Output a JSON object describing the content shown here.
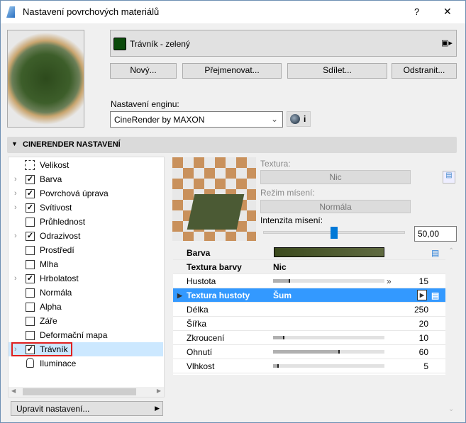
{
  "window": {
    "title": "Nastavení povrchových materiálů",
    "help": "?",
    "close": "✕"
  },
  "material": {
    "name": "Trávník - zelený",
    "swatch": "#0b4a0b"
  },
  "buttons": {
    "new": "Nový...",
    "rename": "Přejmenovat...",
    "share": "Sdílet...",
    "delete": "Odstranit..."
  },
  "engine": {
    "label": "Nastavení enginu:",
    "value": "CineRender by MAXON",
    "info": "i"
  },
  "section": {
    "title": "CINERENDER NASTAVENÍ"
  },
  "tree": [
    {
      "label": "Velikost",
      "type": "size",
      "expand": false
    },
    {
      "label": "Barva",
      "checked": true,
      "expand": true
    },
    {
      "label": "Povrchová úprava",
      "checked": true,
      "expand": true
    },
    {
      "label": "Svítivost",
      "checked": true,
      "expand": true
    },
    {
      "label": "Průhlednost",
      "checked": false,
      "expand": false
    },
    {
      "label": "Odrazivost",
      "checked": true,
      "expand": true
    },
    {
      "label": "Prostředí",
      "checked": false,
      "expand": false
    },
    {
      "label": "Mlha",
      "checked": false,
      "expand": false
    },
    {
      "label": "Hrbolatost",
      "checked": true,
      "expand": true
    },
    {
      "label": "Normála",
      "checked": false,
      "expand": false
    },
    {
      "label": "Alpha",
      "checked": false,
      "expand": false
    },
    {
      "label": "Záře",
      "checked": false,
      "expand": false
    },
    {
      "label": "Deformační mapa",
      "checked": false,
      "expand": false
    },
    {
      "label": "Trávník",
      "checked": true,
      "expand": true,
      "selected": true
    },
    {
      "label": "Iluminace",
      "type": "lock",
      "expand": false
    }
  ],
  "edit_settings": "Upravit nastavení...",
  "texture": {
    "label": "Textura:",
    "value": "Nic",
    "blend_label": "Režim mísení:",
    "blend_value": "Normála",
    "intensity_label": "Intenzita mísení:",
    "intensity_value": "50,00",
    "intensity_fraction": 0.5
  },
  "params": [
    {
      "label": "Barva",
      "type": "color",
      "grey": true,
      "bold": true
    },
    {
      "label": "Textura barvy",
      "value": "Nic",
      "grey": true,
      "bold": true
    },
    {
      "label": "Hustota",
      "number": "15",
      "slider": 0.15
    },
    {
      "label": "Textura hustoty",
      "value": "Šum",
      "selected": true
    },
    {
      "label": "Délka",
      "number": "250"
    },
    {
      "label": "Šířka",
      "number": "20"
    },
    {
      "label": "Zkroucení",
      "number": "10",
      "slider": 0.1
    },
    {
      "label": "Ohnutí",
      "number": "60",
      "slider": 0.6
    },
    {
      "label": "Vlhkost",
      "number": "5",
      "slider": 0.05
    }
  ]
}
